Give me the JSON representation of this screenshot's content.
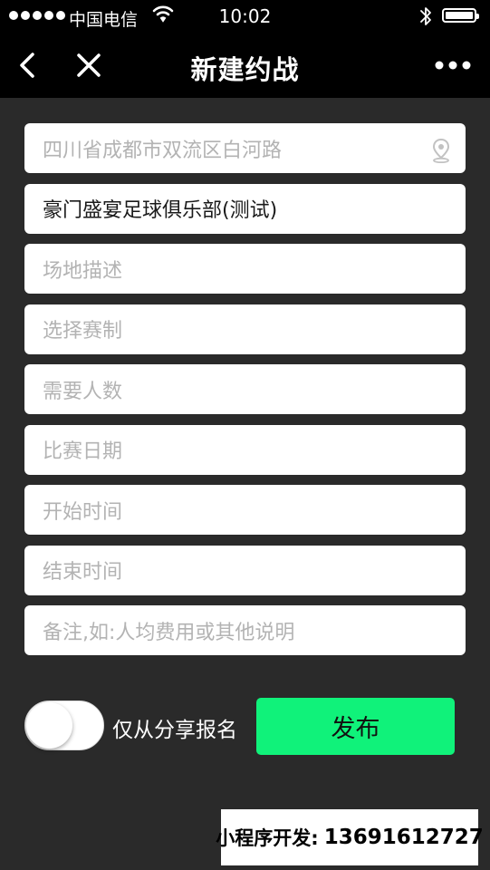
{
  "status_bar": {
    "carrier": "中国电信",
    "time": "10:02",
    "icons": [
      "signal-dots-icon",
      "wifi-icon",
      "bluetooth-icon",
      "battery-icon"
    ]
  },
  "nav": {
    "title": "新建约战",
    "icons": [
      "back-icon",
      "close-icon",
      "more-icon"
    ]
  },
  "form": {
    "fields": [
      {
        "placeholder": "四川省成都市双流区白河路",
        "value": "",
        "icon": "location-pin-icon"
      },
      {
        "placeholder": "",
        "value": "豪门盛宴足球俱乐部(测试)"
      },
      {
        "placeholder": "场地描述",
        "value": ""
      },
      {
        "placeholder": "选择赛制",
        "value": ""
      },
      {
        "placeholder": "需要人数",
        "value": ""
      },
      {
        "placeholder": "比赛日期",
        "value": ""
      },
      {
        "placeholder": "开始时间",
        "value": ""
      },
      {
        "placeholder": "结束时间",
        "value": ""
      },
      {
        "placeholder": "备注,如:人均费用或其他说明",
        "value": ""
      }
    ]
  },
  "share_only": {
    "label": "仅从分享报名",
    "enabled": false
  },
  "publish_label": "发布",
  "watermark": {
    "label": "小程序开发:",
    "phone": "13691612727"
  },
  "colors": {
    "accent": "#10f27a",
    "background": "#2a2a2a",
    "bar": "#000000"
  }
}
